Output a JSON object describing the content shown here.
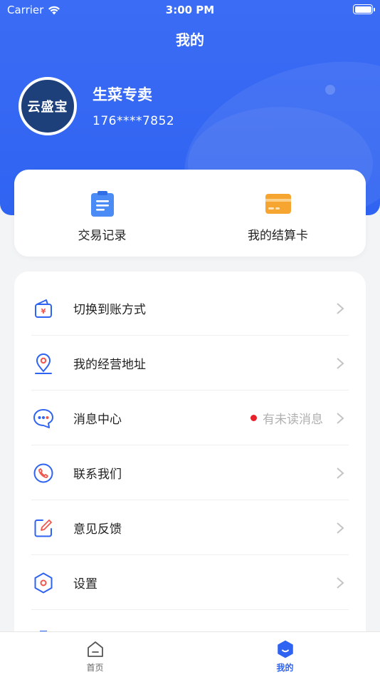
{
  "status_bar": {
    "carrier": "Carrier",
    "time": "3:00 PM"
  },
  "nav": {
    "title": "我的"
  },
  "profile": {
    "avatar_text": "云盛宝",
    "name": "生菜专卖",
    "phone": "176****7852"
  },
  "quick_actions": [
    {
      "label": "交易记录",
      "icon": "clipboard-icon"
    },
    {
      "label": "我的结算卡",
      "icon": "card-icon"
    }
  ],
  "menu": {
    "items": [
      {
        "label": "切换到账方式",
        "icon": "wallet-icon"
      },
      {
        "label": "我的经营地址",
        "icon": "location-pin-icon"
      },
      {
        "label": "消息中心",
        "icon": "chat-bubble-icon",
        "badge_text": "有未读消息"
      },
      {
        "label": "联系我们",
        "icon": "phone-icon"
      },
      {
        "label": "意见反馈",
        "icon": "edit-icon"
      },
      {
        "label": "设置",
        "icon": "hexagon-settings-icon"
      }
    ]
  },
  "tabbar": {
    "tabs": [
      {
        "label": "首页",
        "icon": "home-icon",
        "active": false
      },
      {
        "label": "我的",
        "icon": "user-smile-icon",
        "active": true
      }
    ]
  },
  "colors": {
    "primary": "#2f63f1",
    "header_bg": "#3b6cf5",
    "badge_red": "#e8202a",
    "card_orange": "#f7a531",
    "icon_red": "#f0574f"
  }
}
